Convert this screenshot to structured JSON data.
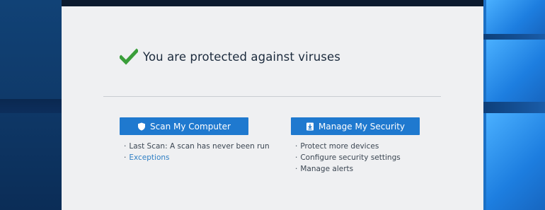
{
  "status": {
    "message": "You are protected against viruses",
    "icon": "check-icon",
    "icon_color": "#3a9e3a"
  },
  "scan": {
    "button_label": "Scan My Computer",
    "button_icon": "shield-icon",
    "items": [
      {
        "text": "Last Scan: A scan has never been run",
        "link": false
      },
      {
        "text": "Exceptions",
        "link": true
      }
    ]
  },
  "security": {
    "button_label": "Manage My Security",
    "button_icon": "download-icon",
    "items": [
      {
        "text": "Protect more devices"
      },
      {
        "text": "Configure security settings"
      },
      {
        "text": "Manage alerts"
      }
    ]
  },
  "colors": {
    "button": "#1f79cf",
    "link": "#2f7fc4",
    "titlebar": "#0b1a2e",
    "window_bg": "#eff0f2"
  }
}
